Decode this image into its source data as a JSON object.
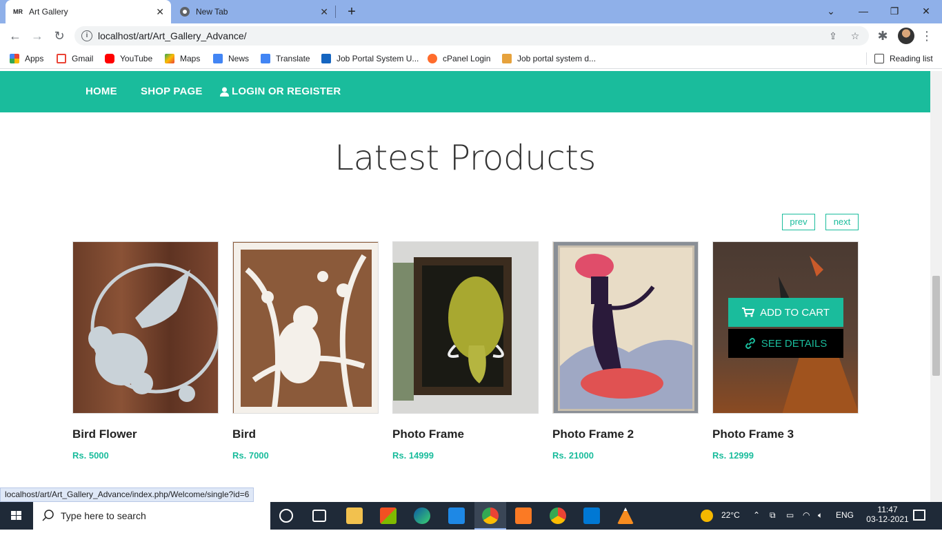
{
  "browser": {
    "tabs": [
      {
        "title": "Art Gallery",
        "favicon": "MR"
      },
      {
        "title": "New Tab"
      }
    ],
    "url": "localhost/art/Art_Gallery_Advance/",
    "bookmarks": [
      "Apps",
      "Gmail",
      "YouTube",
      "Maps",
      "News",
      "Translate",
      "Job Portal System U...",
      "cPanel Login",
      "Job portal system d..."
    ],
    "reading_list": "Reading list",
    "status_url": "localhost/art/Art_Gallery_Advance/index.php/Welcome/single?id=6"
  },
  "site": {
    "nav": {
      "home": "HOME",
      "shop": "SHOP PAGE",
      "login": "LOGIN OR REGISTER"
    },
    "section_title": "Latest Products",
    "pager": {
      "prev": "prev",
      "next": "next"
    },
    "products": [
      {
        "name": "Bird Flower",
        "price": "Rs. 5000"
      },
      {
        "name": "Bird",
        "price": "Rs. 7000"
      },
      {
        "name": "Photo Frame",
        "price": "Rs. 14999"
      },
      {
        "name": "Photo Frame 2",
        "price": "Rs. 21000"
      },
      {
        "name": "Photo Frame 3",
        "price": "Rs. 12999"
      }
    ],
    "overlay": {
      "add_to_cart": "ADD TO CART",
      "see_details": "SEE DETAILS"
    },
    "colors": {
      "accent": "#1abc9c"
    }
  },
  "taskbar": {
    "search_placeholder": "Type here to search",
    "weather": "22°C",
    "language": "ENG",
    "time": "11:47",
    "date": "03-12-2021"
  }
}
